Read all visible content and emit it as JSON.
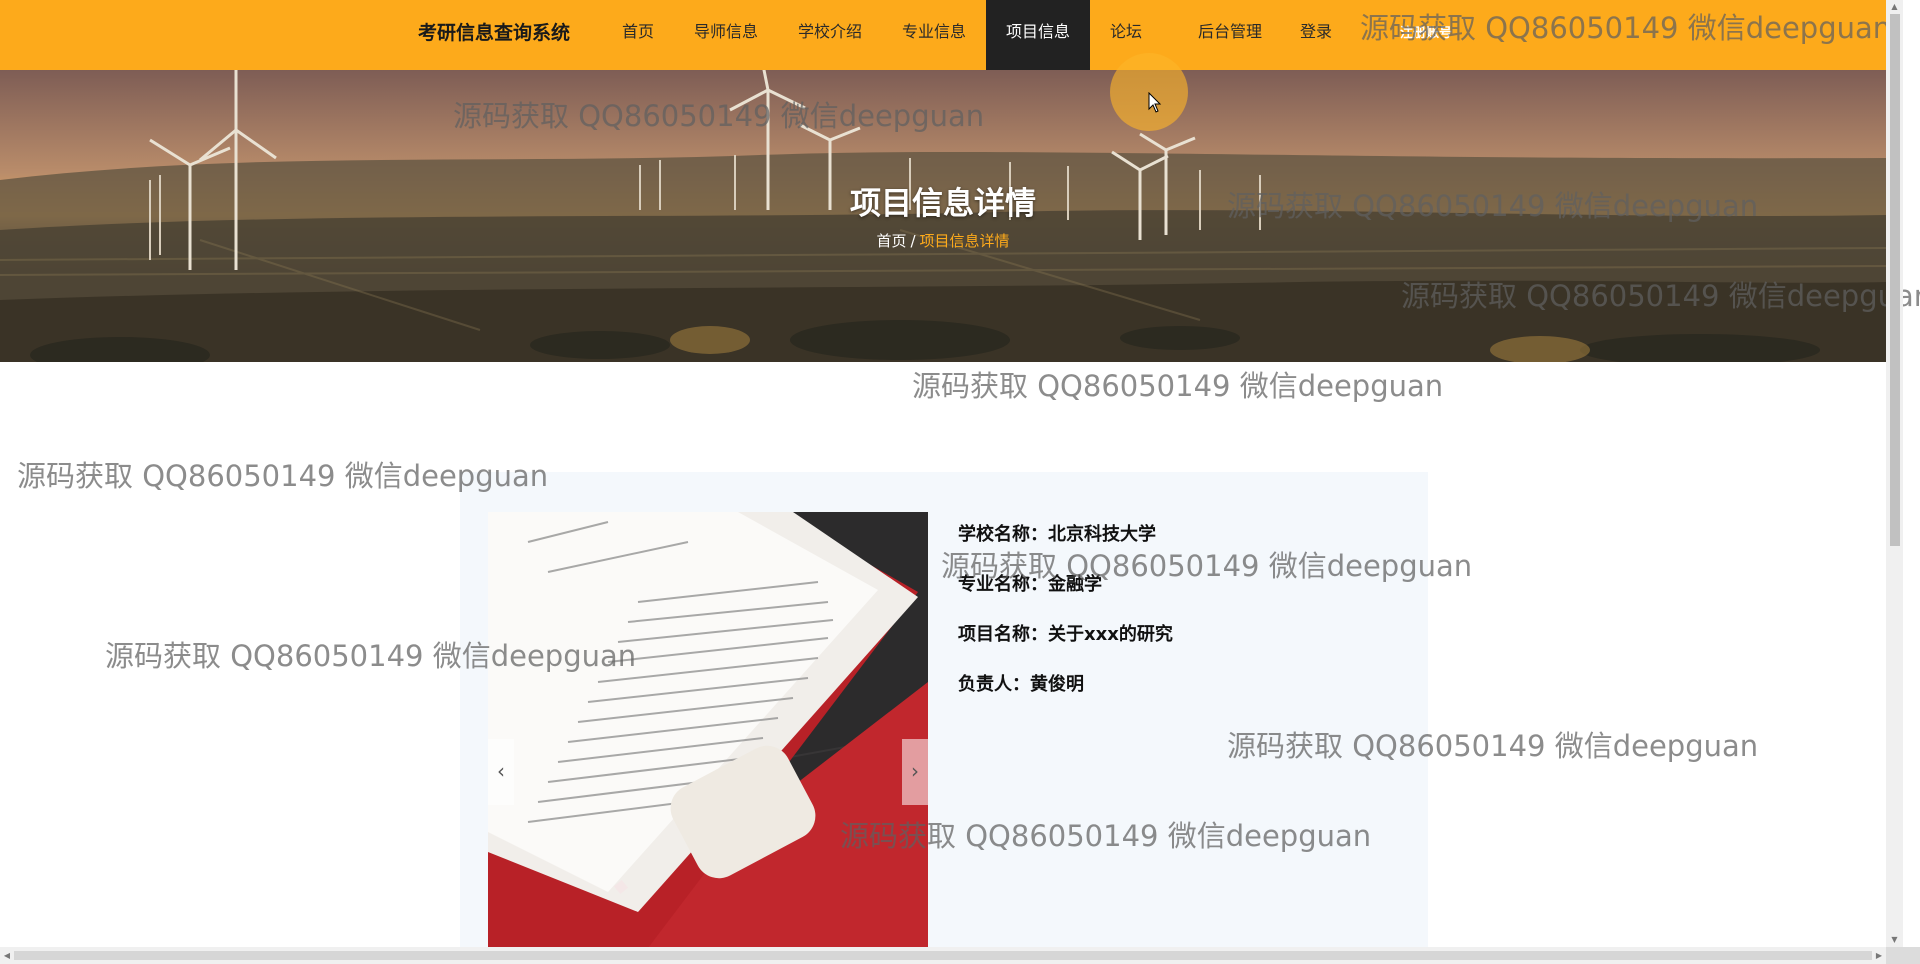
{
  "header": {
    "brand": "考研信息查询系统",
    "nav": [
      {
        "label": "首页",
        "active": false
      },
      {
        "label": "导师信息",
        "active": false
      },
      {
        "label": "学校介绍",
        "active": false
      },
      {
        "label": "专业信息",
        "active": false
      },
      {
        "label": "项目信息",
        "active": true
      },
      {
        "label": "论坛",
        "active": false
      },
      {
        "label": "后台管理",
        "active": false
      },
      {
        "label": "登录",
        "active": false
      }
    ],
    "extra": "注册账号"
  },
  "banner": {
    "title": "项目信息详情",
    "breadcrumb": {
      "home": "首页",
      "separator": "/",
      "current": "项目信息详情"
    }
  },
  "detail": {
    "fields": [
      {
        "label": "学校名称：",
        "value": "北京科技大学"
      },
      {
        "label": "专业名称：",
        "value": "金融学"
      },
      {
        "label": "项目名称：",
        "value": "关于xxx的研究"
      },
      {
        "label": "负责人：",
        "value": "黄俊明"
      }
    ],
    "carousel": {
      "prev": "‹",
      "next": "›"
    }
  },
  "watermark": "源码获取 QQ86050149 微信deepguan",
  "colors": {
    "nav_bg": "#fdaa1b",
    "nav_active": "#222222",
    "accent": "#fdaa1b",
    "card_bg": "#f4f8fc"
  }
}
